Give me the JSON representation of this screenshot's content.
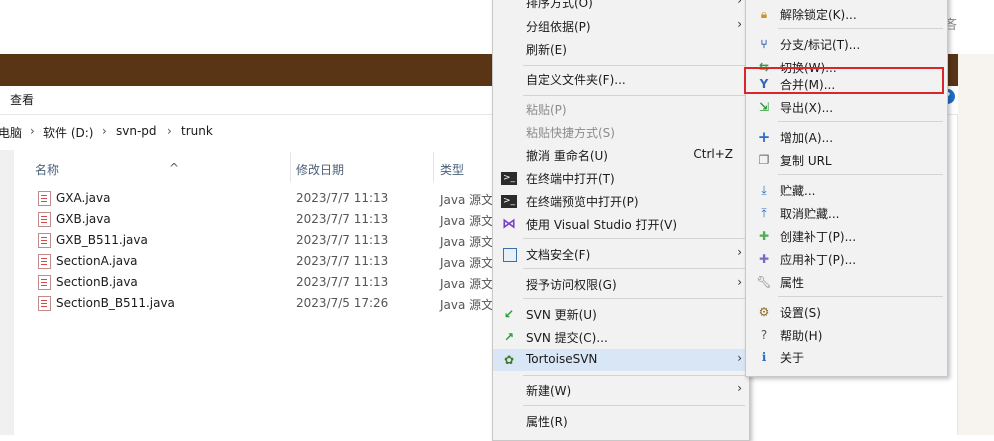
{
  "explorer": {
    "menu": {
      "view": "查看"
    },
    "help_icon": "?",
    "corner_char": "吝",
    "breadcrumb": [
      "电脑",
      "软件 (D:)",
      "svn-pd",
      "trunk"
    ],
    "breadcrumb_sep": "›",
    "columns": {
      "name": "名称",
      "date": "修改日期",
      "type": "类型"
    },
    "files": [
      {
        "name": "GXA.java",
        "date": "2023/7/7 11:13",
        "type": "Java 源文"
      },
      {
        "name": "GXB.java",
        "date": "2023/7/7 11:13",
        "type": "Java 源文"
      },
      {
        "name": "GXB_B511.java",
        "date": "2023/7/7 11:13",
        "type": "Java 源文"
      },
      {
        "name": "SectionA.java",
        "date": "2023/7/7 11:13",
        "type": "Java 源文"
      },
      {
        "name": "SectionB.java",
        "date": "2023/7/7 11:13",
        "type": "Java 源文"
      },
      {
        "name": "SectionB_B511.java",
        "date": "2023/7/5 17:26",
        "type": "Java 源文"
      }
    ]
  },
  "context_menu": {
    "items": [
      {
        "label": "排序方式(O)"
      },
      {
        "label": "分组依据(P)"
      },
      {
        "label": "刷新(E)"
      },
      {
        "label": "自定义文件夹(F)..."
      },
      {
        "label": "粘贴(P)"
      },
      {
        "label": "粘贴快捷方式(S)"
      },
      {
        "label": "撤消 重命名(U)",
        "shortcut": "Ctrl+Z"
      },
      {
        "label": "在终端中打开(T)"
      },
      {
        "label": "在终端预览中打开(P)"
      },
      {
        "label": "使用 Visual Studio 打开(V)"
      },
      {
        "label": "文档安全(F)"
      },
      {
        "label": "授予访问权限(G)"
      },
      {
        "label": "SVN 更新(U)"
      },
      {
        "label": "SVN 提交(C)..."
      },
      {
        "label": "TortoiseSVN"
      },
      {
        "label": "新建(W)"
      },
      {
        "label": "属性(R)"
      }
    ],
    "arrow": "›"
  },
  "tortoise_submenu": {
    "items": [
      {
        "label": "解除锁定(K)..."
      },
      {
        "label": "分支/标记(T)..."
      },
      {
        "label": "切换(W)..."
      },
      {
        "label": "合并(M)..."
      },
      {
        "label": "导出(X)..."
      },
      {
        "label": "增加(A)..."
      },
      {
        "label": "复制 URL"
      },
      {
        "label": "贮藏..."
      },
      {
        "label": "取消贮藏..."
      },
      {
        "label": "创建补丁(P)..."
      },
      {
        "label": "应用补丁(P)..."
      },
      {
        "label": "属性"
      },
      {
        "label": "设置(S)"
      },
      {
        "label": "帮助(H)"
      },
      {
        "label": "关于"
      }
    ]
  },
  "colors": {
    "highlight": "#d9e6f5",
    "focus_border": "#d9262a",
    "titlebar": "#5a3515"
  }
}
